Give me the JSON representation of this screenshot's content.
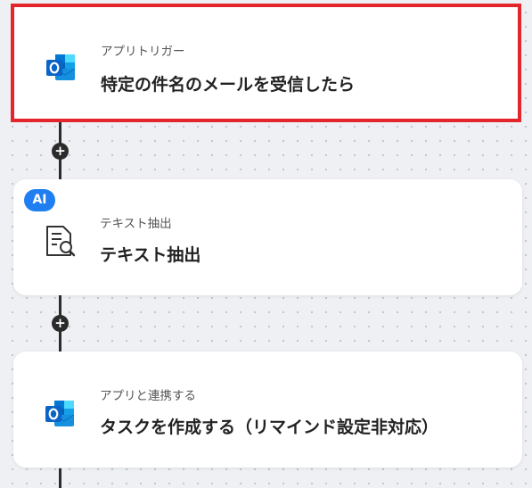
{
  "flow": {
    "steps": [
      {
        "subtitle": "アプリトリガー",
        "title": "特定の件名のメールを受信したら",
        "icon": "outlook-icon",
        "selected": true
      },
      {
        "subtitle": "テキスト抽出",
        "title": "テキスト抽出",
        "icon": "document-search-icon",
        "badge": "AI"
      },
      {
        "subtitle": "アプリと連携する",
        "title": "タスクを作成する（リマインド設定非対応）",
        "icon": "outlook-icon"
      }
    ],
    "add_button_label": "+"
  },
  "colors": {
    "selected_border": "#e3262b",
    "ai_badge": "#1f7ef0",
    "connector": "#2b2b2b",
    "outlook_blue": "#0a64c8"
  }
}
